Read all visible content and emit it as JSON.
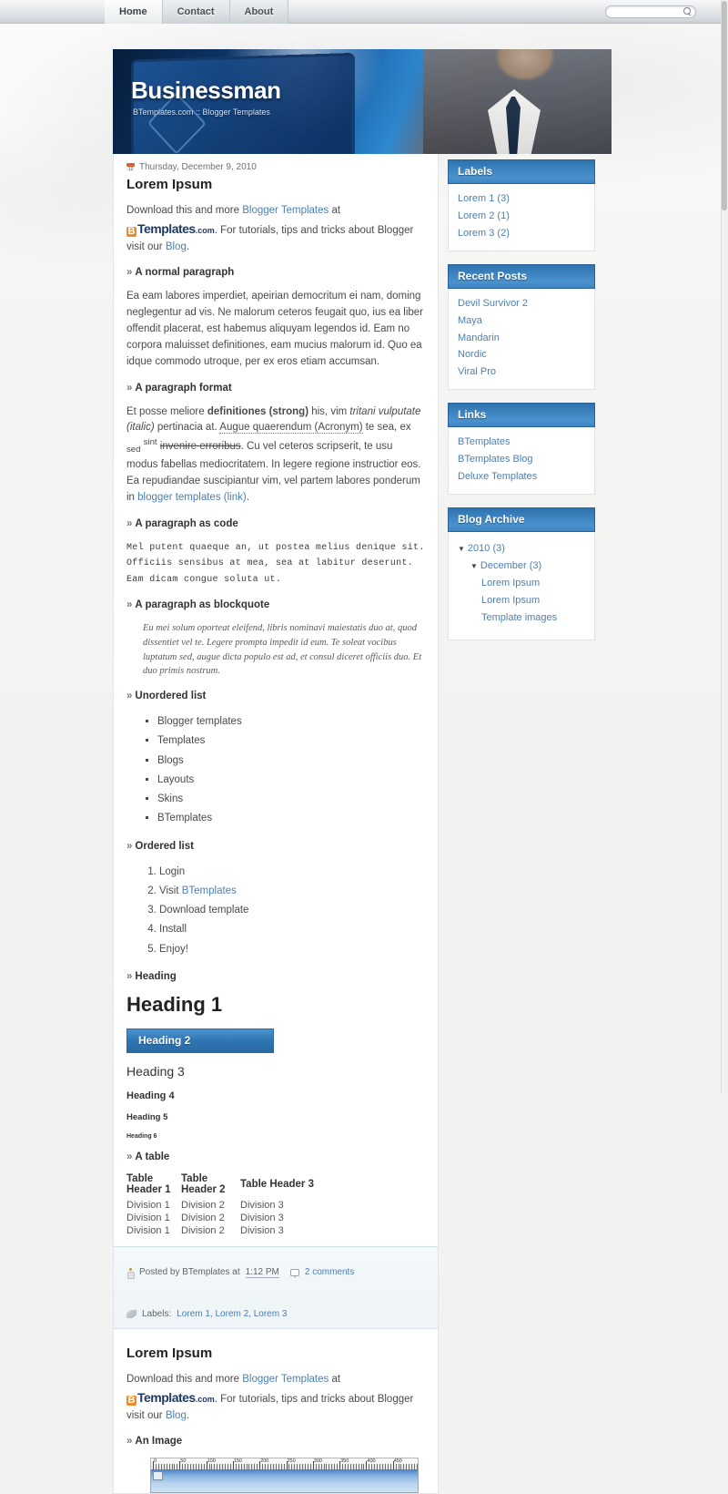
{
  "nav": {
    "tabs": [
      {
        "label": "Home",
        "active": true
      },
      {
        "label": "Contact",
        "active": false
      },
      {
        "label": "About",
        "active": false
      }
    ]
  },
  "search": {
    "value": "",
    "placeholder": "",
    "icon": "search-icon"
  },
  "header": {
    "title": "Businessman",
    "description": "BTemplates.com :: Blogger Templates"
  },
  "post1": {
    "date": "Thursday, December 9, 2010",
    "title": "Lorem Ipsum",
    "intro_a": "Download this and more ",
    "intro_link1": "Blogger Templates",
    "intro_b": " at ",
    "logo_b": "B",
    "logo_word": "Templates",
    "logo_com": ".com",
    "intro_c": ". For tutorials, tips and tricks about Blogger visit our ",
    "intro_link2": "Blog",
    "intro_d": ".",
    "sec_normal": "A normal paragraph",
    "normal_text": "Ea eam labores imperdiet, apeirian democritum ei nam, doming neglegentur ad vis. Ne malorum ceteros feugait quo, ius ea liber offendit placerat, est habemus aliquyam legendos id. Eam no corpora maluisset definitiones, eam mucius malorum id. Quo ea idque commodo utroque, per ex eros etiam accumsan.",
    "sec_format": "A paragraph format",
    "format_1": "Et posse meliore ",
    "format_strong": "definitiones (strong)",
    "format_2": " his, vim ",
    "format_italic": "tritani vulputate (italic)",
    "format_3": " pertinacia at. ",
    "format_acronym": "Augue quaerendum (Acronym)",
    "format_4": " te sea, ex ",
    "format_sub": "sed",
    "format_sup": "sint",
    "format_strike": "invenire erroribus",
    "format_5": ". Cu vel ceteros scripserit, te usu modus fabellas mediocritatem. In legere regione instructior eos. Ea repudiandae suscipiantur vim, vel partem labores ponderum in ",
    "format_link": "blogger templates (link)",
    "format_6": ".",
    "sec_code": "A paragraph as code",
    "code_text": "Mel putent quaeque an, ut postea melius denique sit. Officiis sensibus at mea, sea at labitur deserunt. Eam dicam congue soluta ut.",
    "sec_quote": "A paragraph as blockquote",
    "quote_text": "Eu mei solum oporteat eleifend, libris nominavi maiestatis duo at, quod dissentiet vel te. Legere prompta impedit id eum. Te soleat vocibus luptatum sed, augue dicta populo est ad, et consul diceret officiis duo. Et duo primis nostrum.",
    "sec_ul": "Unordered list",
    "ul_items": [
      "Blogger templates",
      "Templates",
      "Blogs",
      "Layouts",
      "Skins",
      "BTemplates"
    ],
    "sec_ol": "Ordered list",
    "ol_items": [
      {
        "text": "Login",
        "link": ""
      },
      {
        "text": "Visit ",
        "link": "BTemplates"
      },
      {
        "text": "Download template",
        "link": ""
      },
      {
        "text": "Install",
        "link": ""
      },
      {
        "text": "Enjoy!",
        "link": ""
      }
    ],
    "sec_heading": "Heading",
    "h1": "Heading 1",
    "h2": "Heading 2",
    "h3": "Heading 3",
    "h4": "Heading 4",
    "h5": "Heading 5",
    "h6": "Heading 6",
    "sec_table": "A table",
    "table": {
      "headers": [
        "Table Header 1",
        "Table Header 2",
        "Table Header 3"
      ],
      "rows": [
        [
          "Division 1",
          "Division 2",
          "Division 3"
        ],
        [
          "Division 1",
          "Division 2",
          "Division 3"
        ],
        [
          "Division 1",
          "Division 2",
          "Division 3"
        ]
      ]
    },
    "footer": {
      "posted_by": "Posted by BTemplates at",
      "time": "1:12 PM",
      "comments": "2 comments",
      "labels_prefix": "Labels:",
      "labels": "Lorem 1, Lorem 2, Lorem 3"
    }
  },
  "post2": {
    "title": "Lorem Ipsum",
    "intro_a": "Download this and more ",
    "intro_link1": "Blogger Templates",
    "intro_b": " at ",
    "logo_b": "B",
    "logo_word": "Templates",
    "logo_com": ".com",
    "intro_c": ". For tutorials, tips and tricks about Blogger visit our ",
    "intro_link2": "Blog",
    "intro_d": ".",
    "sec_image": "An Image",
    "ruler_labels": [
      "0",
      "50",
      "100",
      "150",
      "200",
      "250",
      "300",
      "350",
      "400",
      "450"
    ]
  },
  "sidebar": {
    "widgets": [
      {
        "title": "Labels",
        "type": "links",
        "items": [
          "Lorem 1 (3)",
          "Lorem 2 (1)",
          "Lorem 3 (2)"
        ]
      },
      {
        "title": "Recent Posts",
        "type": "links",
        "items": [
          "Devil Survivor 2",
          "Maya",
          "Mandarin",
          "Nordic",
          "Viral Pro"
        ]
      },
      {
        "title": "Links",
        "type": "links",
        "items": [
          "BTemplates",
          "BTemplates Blog",
          "Deluxe Templates"
        ]
      },
      {
        "title": "Blog Archive",
        "type": "archive",
        "tree": [
          {
            "level": 1,
            "marker": "▼",
            "label": "2010",
            "count": "(3)"
          },
          {
            "level": 2,
            "marker": "▼",
            "label": "December",
            "count": "(3)"
          },
          {
            "level": 3,
            "marker": "",
            "label": "Lorem Ipsum",
            "count": ""
          },
          {
            "level": 3,
            "marker": "",
            "label": "Lorem Ipsum",
            "count": ""
          },
          {
            "level": 3,
            "marker": "",
            "label": "Template images",
            "count": ""
          }
        ]
      }
    ]
  },
  "colors": {
    "accent_blue": "#3f86c2",
    "header_dark": "#2a6399",
    "link": "#4f7fae",
    "orange": "#f08a24"
  }
}
